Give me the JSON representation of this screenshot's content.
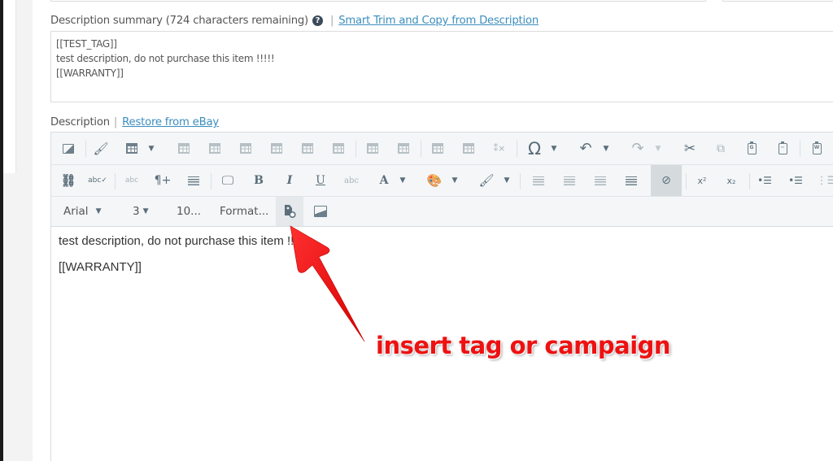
{
  "summary": {
    "label": "Description summary (724 characters remaining)",
    "help_icon": "question-circle-icon",
    "smart_trim_link": "Smart Trim and Copy from Description",
    "lines": [
      "[[TEST_TAG]]",
      "test description, do not purchase this item !!!!!",
      "[[WARRANTY]]"
    ]
  },
  "description": {
    "label": "Description",
    "restore_link": "Restore from eBay",
    "toolbar": {
      "row1": [
        "image-icon",
        "paint-bucket-icon",
        "table-icon",
        "table-row-insert-icon",
        "table-row-below-icon",
        "table-row-delete-icon",
        "table-col-before-icon",
        "table-col-after-icon",
        "table-col-delete-icon",
        "table-merge-icon",
        "table-split-icon",
        "table-cell-merge-icon",
        "table-cell-split-icon",
        "table-delete-icon",
        "special-char-icon",
        "undo-icon",
        "redo-icon",
        "cut-icon",
        "copy-icon",
        "paste-icon",
        "paste-text-icon",
        "paste-word-icon"
      ],
      "row2": [
        "find-icon",
        "spellcheck-icon",
        "text-field-icon",
        "paragraph-icon",
        "align-left-icon",
        "preview-icon",
        "bold-icon",
        "italic-icon",
        "underline-icon",
        "strikethrough-icon",
        "font-color-icon",
        "bg-color-icon",
        "highlight-icon",
        "justify-left-icon",
        "justify-center-icon",
        "justify-right-icon",
        "justify-full-icon",
        "remove-format-icon",
        "superscript-icon",
        "subscript-icon",
        "indent-icon",
        "outdent-icon",
        "list-icon"
      ],
      "glyphs": {
        "bold": "B",
        "italic": "I",
        "underline": "U",
        "strike": "abc",
        "font_color": "A",
        "omega": "Ω",
        "superscript": "x²",
        "subscript": "x₂"
      },
      "font_name": "Arial",
      "font_size": "3",
      "line_height": "10...",
      "format": "Format..."
    },
    "content": [
      "test description, do not purchase this item !!!!!",
      "[[WARRANTY]]"
    ]
  },
  "annotation": {
    "text": "insert tag or campaign",
    "color": "#ee1111"
  }
}
